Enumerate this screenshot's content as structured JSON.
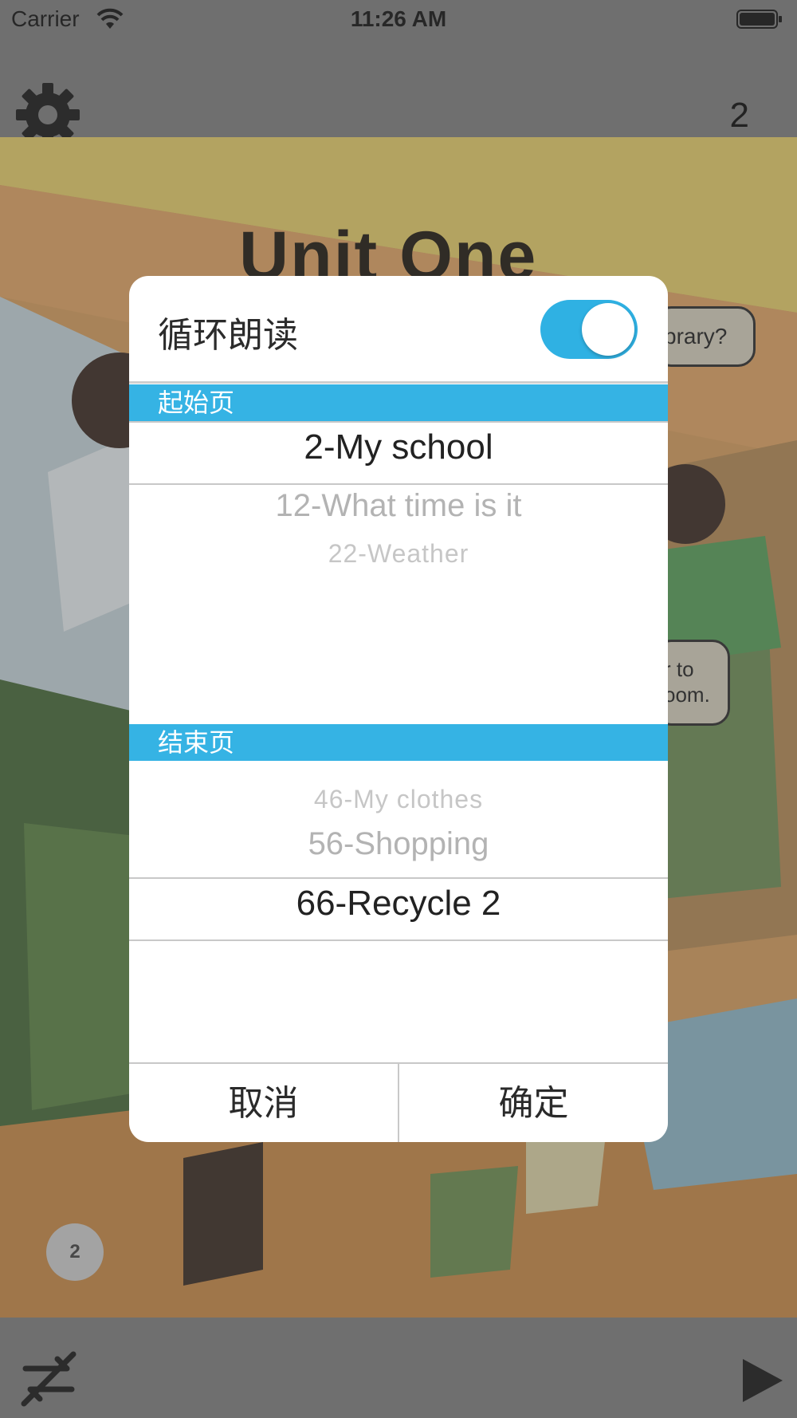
{
  "status_bar": {
    "carrier": "Carrier",
    "time": "11:26 AM"
  },
  "header": {
    "page_number": "2"
  },
  "book": {
    "title": "Unit One",
    "bubble_top": "brary?",
    "bubble_mid": "r to\noom.",
    "page_badge": "2"
  },
  "dialog": {
    "loop_label": "循环朗读",
    "loop_enabled": true,
    "start_section": "起始页",
    "end_section": "结束页",
    "start_picker": {
      "selected": "2-My school",
      "below": [
        "12-What time is it",
        "22-Weather"
      ]
    },
    "end_picker": {
      "above": [
        "46-My clothes",
        "56-Shopping"
      ],
      "selected": "66-Recycle 2"
    },
    "cancel_label": "取消",
    "confirm_label": "确定"
  },
  "colors": {
    "accent": "#35b3e4",
    "overlay": "#808080"
  },
  "icons": {
    "settings": "gear-icon",
    "loop": "loop-disabled-icon",
    "play": "play-icon"
  }
}
